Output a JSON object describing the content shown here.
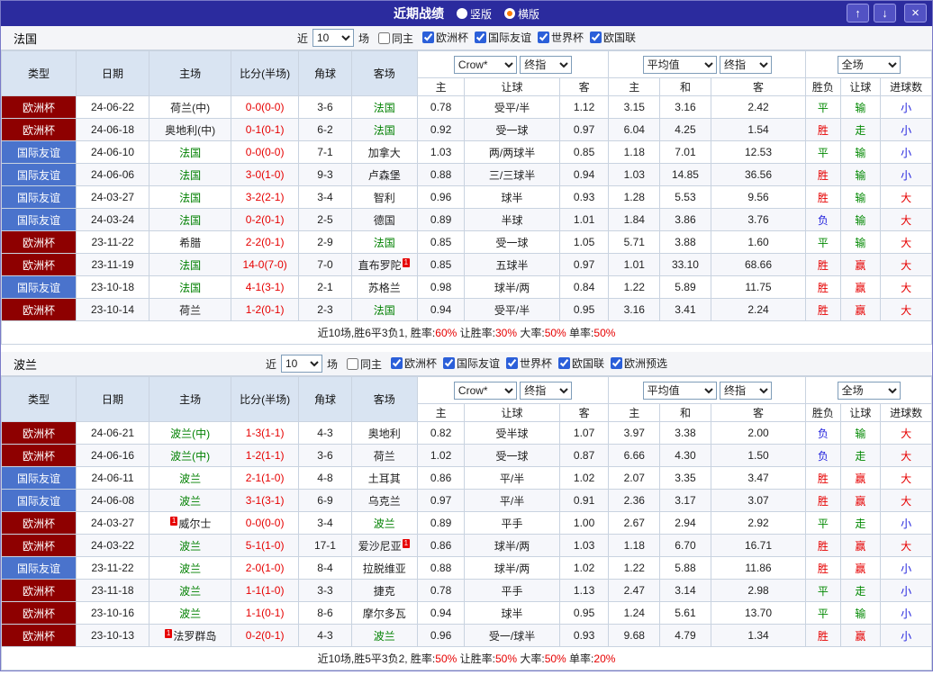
{
  "titlebar": {
    "title": "近期战绩",
    "radios": [
      {
        "label": "竖版",
        "selected": false
      },
      {
        "label": "横版",
        "selected": true
      }
    ],
    "buttons": {
      "up": "↑",
      "down": "↓",
      "close": "×"
    }
  },
  "colors": {
    "accent": "#2b2b9e",
    "comp": {
      "欧洲杯": "#8e0000",
      "国际友谊": "#4a73cc"
    },
    "team_green": "#008000",
    "score_red": "#e60000",
    "result": {
      "胜": "#e60000",
      "平": "#008800",
      "负": "#2222dd",
      "赢": "#e60000",
      "走": "#008800",
      "输": "#008800",
      "大": "#e60000",
      "小": "#2222dd"
    }
  },
  "table_header": {
    "cols": [
      "类型",
      "日期",
      "主场",
      "比分(半场)",
      "角球",
      "客场"
    ],
    "group1": {
      "bookmaker": "Crow*",
      "final": "终指",
      "cols": [
        "主",
        "让球",
        "客"
      ]
    },
    "group2": {
      "average": "平均值",
      "final": "终指",
      "cols": [
        "主",
        "和",
        "客"
      ]
    },
    "group3": {
      "scope": "全场",
      "cols": [
        "胜负",
        "让球",
        "进球数"
      ]
    }
  },
  "sections": [
    {
      "team": "法国",
      "filter": {
        "near_label": "近",
        "count": "10",
        "games_label": "场",
        "same_home_label": "同主",
        "same_home_checked": false,
        "comps": [
          {
            "label": "欧洲杯",
            "checked": true
          },
          {
            "label": "国际友谊",
            "checked": true
          },
          {
            "label": "世界杯",
            "checked": true
          },
          {
            "label": "欧国联",
            "checked": true
          }
        ]
      },
      "rows": [
        {
          "comp": "欧洲杯",
          "date": "24-06-22",
          "home": {
            "name": "荷兰(中)"
          },
          "score": "0-0(0-0)",
          "corner": "3-6",
          "away": {
            "name": "法国",
            "green": true
          },
          "crow": [
            "0.78",
            "受平/半",
            "1.12"
          ],
          "avg": [
            "3.15",
            "3.16",
            "2.42"
          ],
          "results": [
            "平",
            "输",
            "小"
          ]
        },
        {
          "comp": "欧洲杯",
          "date": "24-06-18",
          "home": {
            "name": "奥地利(中)"
          },
          "score": "0-1(0-1)",
          "corner": "6-2",
          "away": {
            "name": "法国",
            "green": true
          },
          "crow": [
            "0.92",
            "受一球",
            "0.97"
          ],
          "avg": [
            "6.04",
            "4.25",
            "1.54"
          ],
          "results": [
            "胜",
            "走",
            "小"
          ]
        },
        {
          "comp": "国际友谊",
          "date": "24-06-10",
          "home": {
            "name": "法国",
            "green": true
          },
          "score": "0-0(0-0)",
          "corner": "7-1",
          "away": {
            "name": "加拿大"
          },
          "crow": [
            "1.03",
            "两/两球半",
            "0.85"
          ],
          "avg": [
            "1.18",
            "7.01",
            "12.53"
          ],
          "results": [
            "平",
            "输",
            "小"
          ]
        },
        {
          "comp": "国际友谊",
          "date": "24-06-06",
          "home": {
            "name": "法国",
            "green": true
          },
          "score": "3-0(1-0)",
          "corner": "9-3",
          "away": {
            "name": "卢森堡"
          },
          "crow": [
            "0.88",
            "三/三球半",
            "0.94"
          ],
          "avg": [
            "1.03",
            "14.85",
            "36.56"
          ],
          "results": [
            "胜",
            "输",
            "小"
          ]
        },
        {
          "comp": "国际友谊",
          "date": "24-03-27",
          "home": {
            "name": "法国",
            "green": true
          },
          "score": "3-2(2-1)",
          "corner": "3-4",
          "away": {
            "name": "智利"
          },
          "crow": [
            "0.96",
            "球半",
            "0.93"
          ],
          "avg": [
            "1.28",
            "5.53",
            "9.56"
          ],
          "results": [
            "胜",
            "输",
            "大"
          ]
        },
        {
          "comp": "国际友谊",
          "date": "24-03-24",
          "home": {
            "name": "法国",
            "green": true
          },
          "score": "0-2(0-1)",
          "corner": "2-5",
          "away": {
            "name": "德国"
          },
          "crow": [
            "0.89",
            "半球",
            "1.01"
          ],
          "avg": [
            "1.84",
            "3.86",
            "3.76"
          ],
          "results": [
            "负",
            "输",
            "大"
          ]
        },
        {
          "comp": "欧洲杯",
          "date": "23-11-22",
          "home": {
            "name": "希腊"
          },
          "score": "2-2(0-1)",
          "corner": "2-9",
          "away": {
            "name": "法国",
            "green": true
          },
          "crow": [
            "0.85",
            "受一球",
            "1.05"
          ],
          "avg": [
            "5.71",
            "3.88",
            "1.60"
          ],
          "results": [
            "平",
            "输",
            "大"
          ]
        },
        {
          "comp": "欧洲杯",
          "date": "23-11-19",
          "home": {
            "name": "法国",
            "green": true
          },
          "score": "14-0(7-0)",
          "corner": "7-0",
          "away": {
            "name": "直布罗陀",
            "badge": "1",
            "badge_pos": "post"
          },
          "crow": [
            "0.85",
            "五球半",
            "0.97"
          ],
          "avg": [
            "1.01",
            "33.10",
            "68.66"
          ],
          "results": [
            "胜",
            "赢",
            "大"
          ]
        },
        {
          "comp": "国际友谊",
          "date": "23-10-18",
          "home": {
            "name": "法国",
            "green": true
          },
          "score": "4-1(3-1)",
          "corner": "2-1",
          "away": {
            "name": "苏格兰"
          },
          "crow": [
            "0.98",
            "球半/两",
            "0.84"
          ],
          "avg": [
            "1.22",
            "5.89",
            "11.75"
          ],
          "results": [
            "胜",
            "赢",
            "大"
          ]
        },
        {
          "comp": "欧洲杯",
          "date": "23-10-14",
          "home": {
            "name": "荷兰"
          },
          "score": "1-2(0-1)",
          "corner": "2-3",
          "away": {
            "name": "法国",
            "green": true
          },
          "crow": [
            "0.94",
            "受平/半",
            "0.95"
          ],
          "avg": [
            "3.16",
            "3.41",
            "2.24"
          ],
          "results": [
            "胜",
            "赢",
            "大"
          ]
        }
      ],
      "summary": [
        {
          "t": "近10场,胜6平3负1, 胜率:",
          "r": false
        },
        {
          "t": "60%",
          "r": true
        },
        {
          "t": " 让胜率:",
          "r": false
        },
        {
          "t": "30%",
          "r": true
        },
        {
          "t": " 大率:",
          "r": false
        },
        {
          "t": "50%",
          "r": true
        },
        {
          "t": " 单率:",
          "r": false
        },
        {
          "t": "50%",
          "r": true
        }
      ]
    },
    {
      "team": "波兰",
      "filter": {
        "near_label": "近",
        "count": "10",
        "games_label": "场",
        "same_home_label": "同主",
        "same_home_checked": false,
        "comps": [
          {
            "label": "欧洲杯",
            "checked": true
          },
          {
            "label": "国际友谊",
            "checked": true
          },
          {
            "label": "世界杯",
            "checked": true
          },
          {
            "label": "欧国联",
            "checked": true
          },
          {
            "label": "欧洲预选",
            "checked": true
          }
        ]
      },
      "rows": [
        {
          "comp": "欧洲杯",
          "date": "24-06-21",
          "home": {
            "name": "波兰(中)",
            "green": true
          },
          "score": "1-3(1-1)",
          "corner": "4-3",
          "away": {
            "name": "奥地利"
          },
          "crow": [
            "0.82",
            "受半球",
            "1.07"
          ],
          "avg": [
            "3.97",
            "3.38",
            "2.00"
          ],
          "results": [
            "负",
            "输",
            "大"
          ]
        },
        {
          "comp": "欧洲杯",
          "date": "24-06-16",
          "home": {
            "name": "波兰(中)",
            "green": true
          },
          "score": "1-2(1-1)",
          "corner": "3-6",
          "away": {
            "name": "荷兰"
          },
          "crow": [
            "1.02",
            "受一球",
            "0.87"
          ],
          "avg": [
            "6.66",
            "4.30",
            "1.50"
          ],
          "results": [
            "负",
            "走",
            "大"
          ]
        },
        {
          "comp": "国际友谊",
          "date": "24-06-11",
          "home": {
            "name": "波兰",
            "green": true
          },
          "score": "2-1(1-0)",
          "corner": "4-8",
          "away": {
            "name": "土耳其"
          },
          "crow": [
            "0.86",
            "平/半",
            "1.02"
          ],
          "avg": [
            "2.07",
            "3.35",
            "3.47"
          ],
          "results": [
            "胜",
            "赢",
            "大"
          ]
        },
        {
          "comp": "国际友谊",
          "date": "24-06-08",
          "home": {
            "name": "波兰",
            "green": true
          },
          "score": "3-1(3-1)",
          "corner": "6-9",
          "away": {
            "name": "乌克兰"
          },
          "crow": [
            "0.97",
            "平/半",
            "0.91"
          ],
          "avg": [
            "2.36",
            "3.17",
            "3.07"
          ],
          "results": [
            "胜",
            "赢",
            "大"
          ]
        },
        {
          "comp": "欧洲杯",
          "date": "24-03-27",
          "home": {
            "name": "威尔士",
            "badge": "1",
            "badge_pos": "pre"
          },
          "score": "0-0(0-0)",
          "corner": "3-4",
          "away": {
            "name": "波兰",
            "green": true
          },
          "crow": [
            "0.89",
            "平手",
            "1.00"
          ],
          "avg": [
            "2.67",
            "2.94",
            "2.92"
          ],
          "results": [
            "平",
            "走",
            "小"
          ]
        },
        {
          "comp": "欧洲杯",
          "date": "24-03-22",
          "home": {
            "name": "波兰",
            "green": true
          },
          "score": "5-1(1-0)",
          "corner": "17-1",
          "away": {
            "name": "爱沙尼亚",
            "badge": "1",
            "badge_pos": "post"
          },
          "crow": [
            "0.86",
            "球半/两",
            "1.03"
          ],
          "avg": [
            "1.18",
            "6.70",
            "16.71"
          ],
          "results": [
            "胜",
            "赢",
            "大"
          ]
        },
        {
          "comp": "国际友谊",
          "date": "23-11-22",
          "home": {
            "name": "波兰",
            "green": true
          },
          "score": "2-0(1-0)",
          "corner": "8-4",
          "away": {
            "name": "拉脱维亚"
          },
          "crow": [
            "0.88",
            "球半/两",
            "1.02"
          ],
          "avg": [
            "1.22",
            "5.88",
            "11.86"
          ],
          "results": [
            "胜",
            "赢",
            "小"
          ]
        },
        {
          "comp": "欧洲杯",
          "date": "23-11-18",
          "home": {
            "name": "波兰",
            "green": true
          },
          "score": "1-1(1-0)",
          "corner": "3-3",
          "away": {
            "name": "捷克"
          },
          "crow": [
            "0.78",
            "平手",
            "1.13"
          ],
          "avg": [
            "2.47",
            "3.14",
            "2.98"
          ],
          "results": [
            "平",
            "走",
            "小"
          ]
        },
        {
          "comp": "欧洲杯",
          "date": "23-10-16",
          "home": {
            "name": "波兰",
            "green": true
          },
          "score": "1-1(0-1)",
          "corner": "8-6",
          "away": {
            "name": "摩尔多瓦"
          },
          "crow": [
            "0.94",
            "球半",
            "0.95"
          ],
          "avg": [
            "1.24",
            "5.61",
            "13.70"
          ],
          "results": [
            "平",
            "输",
            "小"
          ]
        },
        {
          "comp": "欧洲杯",
          "date": "23-10-13",
          "home": {
            "name": "法罗群岛",
            "badge": "1",
            "badge_pos": "pre"
          },
          "score": "0-2(0-1)",
          "corner": "4-3",
          "away": {
            "name": "波兰",
            "green": true
          },
          "crow": [
            "0.96",
            "受一/球半",
            "0.93"
          ],
          "avg": [
            "9.68",
            "4.79",
            "1.34"
          ],
          "results": [
            "胜",
            "赢",
            "小"
          ]
        }
      ],
      "summary": [
        {
          "t": "近10场,胜5平3负2, 胜率:",
          "r": false
        },
        {
          "t": "50%",
          "r": true
        },
        {
          "t": " 让胜率:",
          "r": false
        },
        {
          "t": "50%",
          "r": true
        },
        {
          "t": " 大率:",
          "r": false
        },
        {
          "t": "50%",
          "r": true
        },
        {
          "t": " 单率:",
          "r": false
        },
        {
          "t": "20%",
          "r": true
        }
      ]
    }
  ]
}
